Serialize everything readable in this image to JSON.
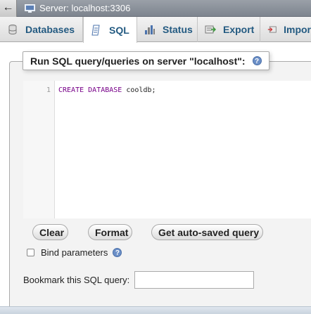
{
  "topbar": {
    "back_label": "←",
    "server_label": "Server: localhost:3306"
  },
  "tabs": [
    {
      "label": "Databases",
      "icon": "database-icon",
      "active": false
    },
    {
      "label": "SQL",
      "icon": "sql-icon",
      "active": true
    },
    {
      "label": "Status",
      "icon": "status-icon",
      "active": false
    },
    {
      "label": "Export",
      "icon": "export-icon",
      "active": false
    },
    {
      "label": "Impor",
      "icon": "import-icon",
      "active": false
    }
  ],
  "panel": {
    "legend": "Run SQL query/queries on server \"localhost\":",
    "help_glyph": "?"
  },
  "editor": {
    "line_number": "1",
    "keyword1": "CREATE",
    "keyword2": "DATABASE",
    "identifier": "cooldb;"
  },
  "buttons": {
    "clear": "Clear",
    "format": "Format",
    "autosaved": "Get auto-saved query"
  },
  "bind_params": {
    "label": "Bind parameters",
    "checked": false,
    "help_glyph": "?"
  },
  "bookmark": {
    "label": "Bookmark this SQL query:",
    "value": ""
  },
  "colors": {
    "tab_text": "#235a81",
    "keyword": "#770088",
    "topbar": "#8a9099"
  }
}
